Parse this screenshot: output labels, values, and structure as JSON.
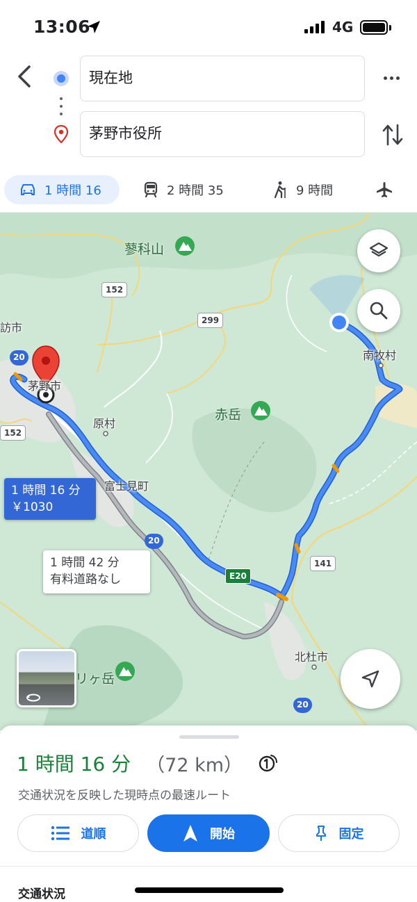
{
  "status_bar": {
    "time": "13:06",
    "network": "4G"
  },
  "search": {
    "origin": "現在地",
    "destination": "茅野市役所"
  },
  "modes": [
    {
      "name": "car",
      "label": "1 時間 16",
      "active": true
    },
    {
      "name": "transit",
      "label": "2 時間 35",
      "active": false
    },
    {
      "name": "walk",
      "label": "9 時間",
      "active": false
    },
    {
      "name": "flight",
      "label": "",
      "active": false
    }
  ],
  "map": {
    "labels": {
      "tateshina": "蓼科山",
      "haramura": "原村",
      "fujimi": "富士見町",
      "akadake": "赤岳",
      "minamimaki": "南牧村",
      "hokuto": "北杜市",
      "chino_city": "茅野市",
      "suwa_partial": "訪市",
      "kayagatake_partial": "リヶ岳"
    },
    "shields": {
      "r152_top": "152",
      "r299": "299",
      "r20_left": "20",
      "r152_left": "152",
      "r20_mid": "20",
      "e20": "E20",
      "r141": "141",
      "r20_bottom": "20"
    },
    "route_callout": {
      "duration": "1 時間 16 分",
      "toll": "￥1030"
    },
    "alt_callout": {
      "duration": "1 時間 42 分",
      "note": "有料道路なし"
    }
  },
  "sheet": {
    "duration": "1 時間 16 分",
    "distance": "（72 km）",
    "subtitle": "交通状況を反映した現時点の最速ルート",
    "buttons": {
      "steps": "道順",
      "start": "開始",
      "pin": "固定"
    },
    "section_title": "交通状況"
  },
  "colors": {
    "accent": "#1a73e8",
    "route": "#4a8af4",
    "duration_green": "#188038",
    "map_bg": "#cfe8d6"
  }
}
